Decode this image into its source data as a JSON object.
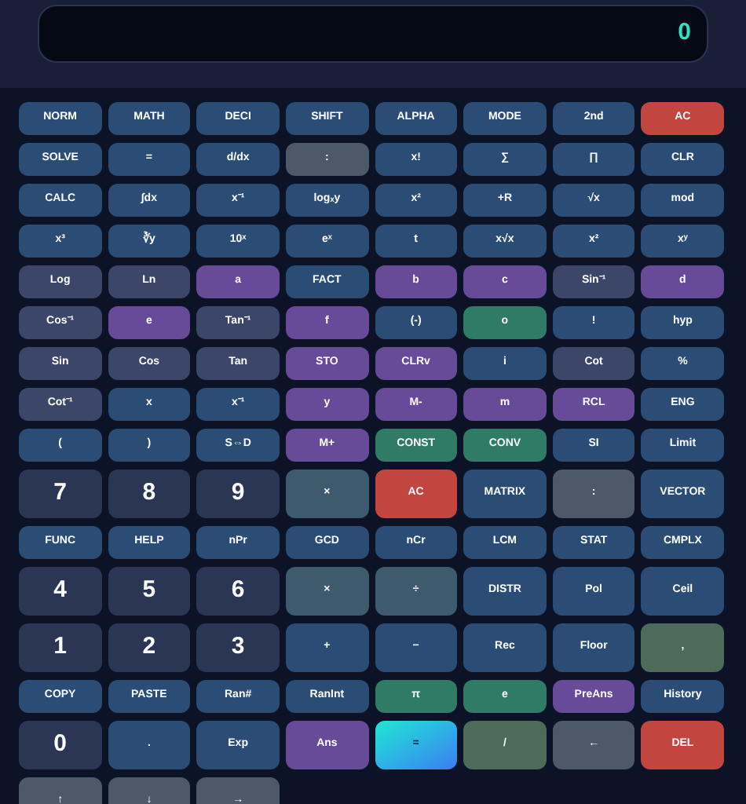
{
  "display": {
    "value": "0"
  },
  "rows": [
    {
      "kind": "small",
      "keys": [
        {
          "label": "NORM",
          "kind": "blue"
        },
        {
          "label": "MATH",
          "kind": "blue"
        },
        {
          "label": "DECI",
          "kind": "blue"
        },
        {
          "label": "SHIFT",
          "kind": "blue"
        },
        {
          "label": "ALPHA",
          "kind": "blue"
        },
        {
          "label": "MODE",
          "kind": "blue"
        },
        {
          "label": "2nd",
          "kind": "blue"
        },
        {
          "label": "AC",
          "kind": "red"
        }
      ]
    },
    {
      "kind": "small",
      "keys": [
        {
          "label": "SOLVE",
          "kind": "blue"
        },
        {
          "label": "=",
          "kind": "blue"
        },
        {
          "label": "d/dx",
          "kind": "blue"
        },
        {
          "label": ":",
          "kind": "gray"
        },
        {
          "label": "x!",
          "kind": "blue"
        },
        {
          "label": "∑",
          "kind": "blue"
        },
        {
          "label": "∏",
          "kind": "blue"
        },
        {
          "label": "CLR",
          "kind": "blue"
        }
      ]
    },
    {
      "kind": "small",
      "keys": [
        {
          "label": "CALC",
          "kind": "blue"
        },
        {
          "label": "∫dx",
          "kind": "blue"
        },
        {
          "label": "x⁻¹",
          "kind": "blue"
        },
        {
          "label": "logₓy",
          "kind": "blue"
        },
        {
          "label": "x²",
          "kind": "blue"
        },
        {
          "label": "+R",
          "kind": "blue"
        },
        {
          "label": "√x",
          "kind": "blue"
        },
        {
          "label": "mod",
          "kind": "blue"
        }
      ]
    },
    {
      "kind": "small",
      "keys": [
        {
          "label": "x³",
          "kind": "blue"
        },
        {
          "label": "∛y",
          "kind": "blue"
        },
        {
          "label": "10ˣ",
          "kind": "blue"
        },
        {
          "label": "eˣ",
          "kind": "blue"
        },
        {
          "label": "t",
          "kind": "blue"
        },
        {
          "label": "x√x",
          "kind": "blue"
        },
        {
          "label": "x²",
          "kind": "blue"
        },
        {
          "label": "xʸ",
          "kind": "blue"
        }
      ]
    },
    {
      "kind": "small",
      "keys": [
        {
          "label": "Log",
          "kind": "slate"
        },
        {
          "label": "Ln",
          "kind": "slate"
        },
        {
          "label": "a",
          "kind": "purple"
        },
        {
          "label": "FACT",
          "kind": "blue"
        },
        {
          "label": "b",
          "kind": "purple"
        },
        {
          "label": "c",
          "kind": "purple"
        },
        {
          "label": "Sin⁻¹",
          "kind": "slate"
        },
        {
          "label": "d",
          "kind": "purple"
        }
      ]
    },
    {
      "kind": "small",
      "keys": [
        {
          "label": "Cos⁻¹",
          "kind": "slate"
        },
        {
          "label": "e",
          "kind": "purple"
        },
        {
          "label": "Tan⁻¹",
          "kind": "slate"
        },
        {
          "label": "f",
          "kind": "purple"
        },
        {
          "label": "(-)",
          "kind": "blue"
        },
        {
          "label": "o",
          "kind": "green"
        },
        {
          "label": "!",
          "kind": "blue"
        },
        {
          "label": "hyp",
          "kind": "blue"
        }
      ]
    },
    {
      "kind": "small",
      "keys": [
        {
          "label": "Sin",
          "kind": "slate"
        },
        {
          "label": "Cos",
          "kind": "slate"
        },
        {
          "label": "Tan",
          "kind": "slate"
        },
        {
          "label": "STO",
          "kind": "purple"
        },
        {
          "label": "CLRv",
          "kind": "purple"
        },
        {
          "label": "i",
          "kind": "blue"
        },
        {
          "label": "Cot",
          "kind": "slate"
        },
        {
          "label": "%",
          "kind": "blue"
        }
      ]
    },
    {
      "kind": "small",
      "keys": [
        {
          "label": "Cot⁻¹",
          "kind": "slate"
        },
        {
          "label": "x",
          "kind": "blue"
        },
        {
          "label": "x⁻¹",
          "kind": "blue"
        },
        {
          "label": "y",
          "kind": "purple"
        },
        {
          "label": "M-",
          "kind": "purple"
        },
        {
          "label": "m",
          "kind": "purple"
        },
        {
          "label": "RCL",
          "kind": "purple"
        },
        {
          "label": "ENG",
          "kind": "blue"
        }
      ]
    },
    {
      "kind": "small",
      "keys": [
        {
          "label": "(",
          "kind": "blue"
        },
        {
          "label": ")",
          "kind": "blue"
        },
        {
          "label": "S⇔D",
          "kind": "blue"
        },
        {
          "label": "M+",
          "kind": "purple"
        },
        {
          "label": "CONST",
          "kind": "green"
        },
        {
          "label": "CONV",
          "kind": "green"
        },
        {
          "label": "SI",
          "kind": "blue"
        },
        {
          "label": "Limit",
          "kind": "blue"
        }
      ]
    },
    {
      "kind": "large",
      "keys": [
        {
          "label": "7",
          "kind": "digit"
        },
        {
          "label": "8",
          "kind": "digit"
        },
        {
          "label": "9",
          "kind": "digit"
        },
        {
          "label": "×",
          "kind": "steel"
        },
        {
          "label": "AC",
          "kind": "red"
        },
        {
          "label": "MATRIX",
          "kind": "blue"
        },
        {
          "label": ":",
          "kind": "gray"
        },
        {
          "label": "VECTOR",
          "kind": "blue"
        }
      ]
    },
    {
      "kind": "small",
      "keys": [
        {
          "label": "FUNC",
          "kind": "blue"
        },
        {
          "label": "HELP",
          "kind": "blue"
        },
        {
          "label": "nPr",
          "kind": "blue"
        },
        {
          "label": "GCD",
          "kind": "blue"
        },
        {
          "label": "nCr",
          "kind": "blue"
        },
        {
          "label": "LCM",
          "kind": "blue"
        },
        {
          "label": "STAT",
          "kind": "blue"
        },
        {
          "label": "CMPLX",
          "kind": "blue"
        }
      ]
    },
    {
      "kind": "large",
      "keys": [
        {
          "label": "4",
          "kind": "digit"
        },
        {
          "label": "5",
          "kind": "digit"
        },
        {
          "label": "6",
          "kind": "digit"
        },
        {
          "label": "×",
          "kind": "steel"
        },
        {
          "label": "÷",
          "kind": "steel"
        },
        {
          "label": "DISTR",
          "kind": "blue"
        },
        {
          "label": "Pol",
          "kind": "blue"
        },
        {
          "label": "Ceil",
          "kind": "blue"
        }
      ]
    },
    {
      "kind": "large",
      "keys": [
        {
          "label": "1",
          "kind": "digit"
        },
        {
          "label": "2",
          "kind": "digit"
        },
        {
          "label": "3",
          "kind": "digit"
        },
        {
          "label": "+",
          "kind": "blue"
        },
        {
          "label": "−",
          "kind": "blue"
        },
        {
          "label": "Rec",
          "kind": "blue"
        },
        {
          "label": "Floor",
          "kind": "blue"
        },
        {
          "label": ",",
          "kind": "olive"
        }
      ]
    },
    {
      "kind": "small",
      "keys": [
        {
          "label": "COPY",
          "kind": "blue"
        },
        {
          "label": "PASTE",
          "kind": "blue"
        },
        {
          "label": "Ran#",
          "kind": "blue"
        },
        {
          "label": "RanInt",
          "kind": "blue"
        },
        {
          "label": "π",
          "kind": "green"
        },
        {
          "label": "e",
          "kind": "green"
        },
        {
          "label": "PreAns",
          "kind": "purple"
        },
        {
          "label": "History",
          "kind": "blue"
        }
      ]
    },
    {
      "kind": "large",
      "keys": [
        {
          "label": "0",
          "kind": "digit"
        },
        {
          "label": ".",
          "kind": "blue"
        },
        {
          "label": "Exp",
          "kind": "blue"
        },
        {
          "label": "Ans",
          "kind": "purple"
        },
        {
          "label": "=",
          "kind": "equals"
        },
        {
          "label": "/",
          "kind": "olive"
        },
        {
          "label": "←",
          "kind": "gray"
        },
        {
          "label": "DEL",
          "kind": "red"
        }
      ]
    },
    {
      "kind": "large",
      "keys": [
        {
          "label": "↑",
          "kind": "gray"
        },
        {
          "label": "↓",
          "kind": "gray"
        },
        {
          "label": "→",
          "kind": "gray"
        }
      ]
    }
  ]
}
